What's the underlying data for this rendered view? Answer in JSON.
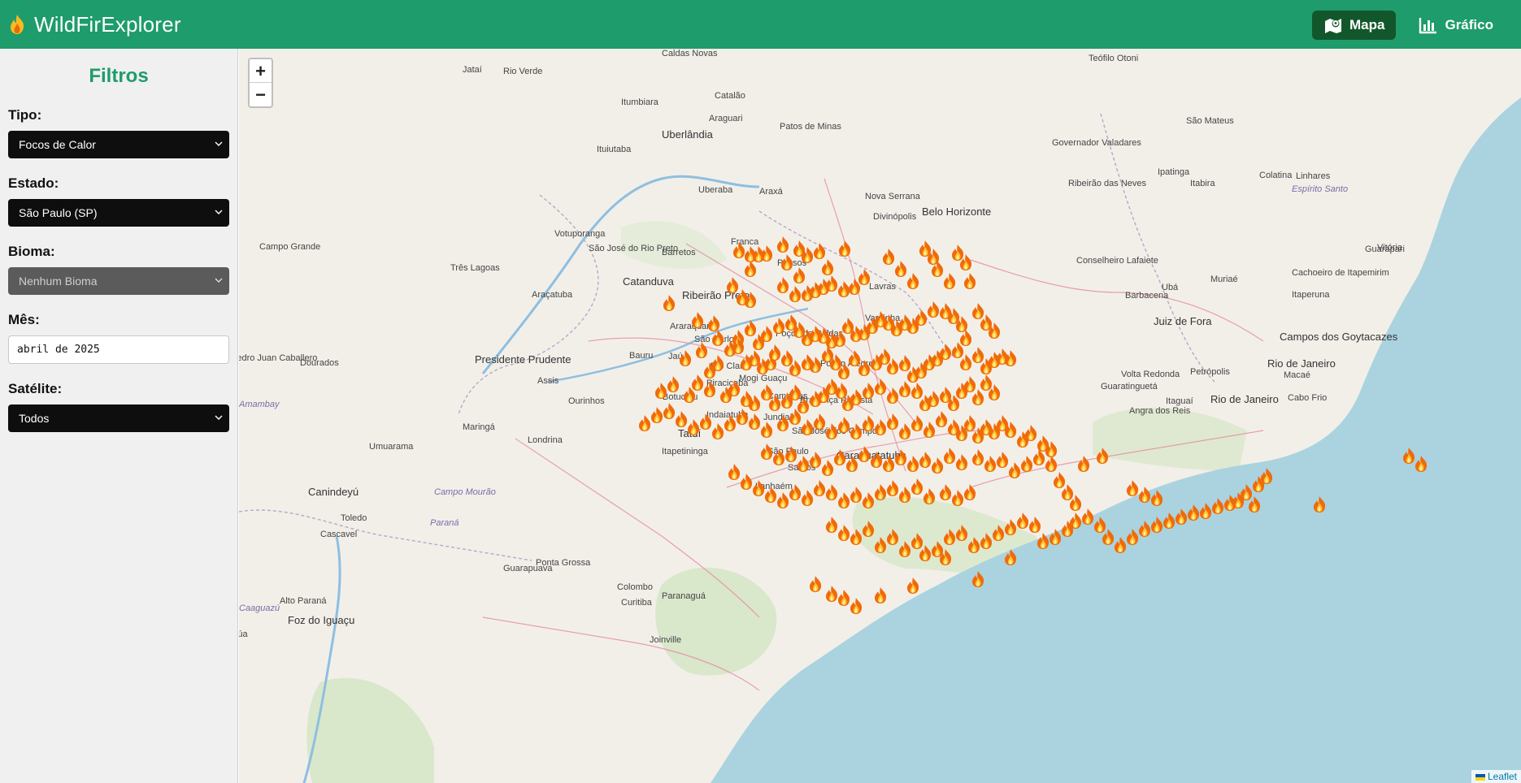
{
  "app": {
    "title": "WildFirExplorer"
  },
  "nav": {
    "map_label": "Mapa",
    "chart_label": "Gráfico"
  },
  "colors": {
    "header": "#1e9c6b",
    "active_nav": "#12572b",
    "sea": "#aad3df",
    "land": "#f2efe9"
  },
  "filters": {
    "title": "Filtros",
    "tipo": {
      "label": "Tipo:",
      "value": "Focos de Calor"
    },
    "estado": {
      "label": "Estado:",
      "value": "São Paulo (SP)"
    },
    "bioma": {
      "label": "Bioma:",
      "value": "Nenhum Bioma"
    },
    "mes": {
      "label": "Mês:",
      "value": "abril de 2025"
    },
    "satelite": {
      "label": "Satélite:",
      "value": "Todos"
    }
  },
  "map": {
    "zoom_in": "+",
    "zoom_out": "−",
    "attribution": "Leaflet",
    "places": [
      {
        "name": "Jataí"
      },
      {
        "name": "Rio Verde"
      },
      {
        "name": "Caldas Novas"
      },
      {
        "name": "Itumbiara"
      },
      {
        "name": "Catalão"
      },
      {
        "name": "Araguari"
      },
      {
        "name": "Uberlândia"
      },
      {
        "name": "Patos de Minas"
      },
      {
        "name": "Ituiutaba"
      },
      {
        "name": "Uberaba"
      },
      {
        "name": "Araxá"
      },
      {
        "name": "Teófilo Otoni"
      },
      {
        "name": "São Mateus"
      },
      {
        "name": "Governador Valadares"
      },
      {
        "name": "Ipatinga"
      },
      {
        "name": "Itabira"
      },
      {
        "name": "Ribeirão das Neves"
      },
      {
        "name": "Colatina"
      },
      {
        "name": "Linhares"
      },
      {
        "name": "Espírito Santo"
      },
      {
        "name": "Nova Serrana"
      },
      {
        "name": "Divinópolis"
      },
      {
        "name": "Belo Horizonte"
      },
      {
        "name": "Vitória"
      },
      {
        "name": "Guarapari"
      },
      {
        "name": "Campo Grande"
      },
      {
        "name": "Votuporanga"
      },
      {
        "name": "São José do Rio Preto"
      },
      {
        "name": "Barretos"
      },
      {
        "name": "Franca"
      },
      {
        "name": "Passos"
      },
      {
        "name": "Conselheiro Lafaiete"
      },
      {
        "name": "Ubá"
      },
      {
        "name": "Muriaé"
      },
      {
        "name": "Cachoeiro de Itapemirim"
      },
      {
        "name": "Três Lagoas"
      },
      {
        "name": "Catanduva"
      },
      {
        "name": "Ribeirão Preto"
      },
      {
        "name": "Lavras"
      },
      {
        "name": "Barbacena"
      },
      {
        "name": "Itaperuna"
      },
      {
        "name": "Araçatuba"
      },
      {
        "name": "Araraquara"
      },
      {
        "name": "São Carlos"
      },
      {
        "name": "Varginha"
      },
      {
        "name": "Juiz de Fora"
      },
      {
        "name": "Campos dos Goytacazes"
      },
      {
        "name": "Poços de Caldas"
      },
      {
        "name": "Presidente Prudente"
      },
      {
        "name": "Bauru"
      },
      {
        "name": "Jaú"
      },
      {
        "name": "Rio Claro"
      },
      {
        "name": "Mogi Guaçu"
      },
      {
        "name": "Pouso Alegre"
      },
      {
        "name": "Rio de Janeiro"
      },
      {
        "name": "Pedro Juan Caballero"
      },
      {
        "name": "Dourados"
      },
      {
        "name": "Assis"
      },
      {
        "name": "Ourinhos"
      },
      {
        "name": "Botucatu"
      },
      {
        "name": "Piracicaba"
      },
      {
        "name": "Campinas"
      },
      {
        "name": "Volta Redonda"
      },
      {
        "name": "Petrópolis"
      },
      {
        "name": "Macaé"
      },
      {
        "name": "Guaratinguetá"
      },
      {
        "name": "Bragança Paulista"
      },
      {
        "name": "Itaguaí"
      },
      {
        "name": "Rio de Janeiro"
      },
      {
        "name": "Cabo Frio"
      },
      {
        "name": "Amambay"
      },
      {
        "name": "Indaiatuba"
      },
      {
        "name": "Jundiaí"
      },
      {
        "name": "Angra dos Reis"
      },
      {
        "name": "Maringá"
      },
      {
        "name": "Londrina"
      },
      {
        "name": "Tatuí"
      },
      {
        "name": "São José dos Campos"
      },
      {
        "name": "Umuarama"
      },
      {
        "name": "Itapetininga"
      },
      {
        "name": "São Paulo"
      },
      {
        "name": "Santos"
      },
      {
        "name": "Caraguatatuba"
      },
      {
        "name": "Canindeyú"
      },
      {
        "name": "Campo Mourão"
      },
      {
        "name": "Itanhaém"
      },
      {
        "name": "Toledo"
      },
      {
        "name": "Paraná"
      },
      {
        "name": "Cascavel"
      },
      {
        "name": "Ponta Grossa"
      },
      {
        "name": "Guarapuava"
      },
      {
        "name": "Colombo"
      },
      {
        "name": "Paranaguá"
      },
      {
        "name": "Alto Paraná"
      },
      {
        "name": "Caaguazú"
      },
      {
        "name": "Curitiba"
      },
      {
        "name": "Foz do Iguaçu"
      },
      {
        "name": "Joinville"
      },
      {
        "name": "Itapúa"
      }
    ]
  }
}
